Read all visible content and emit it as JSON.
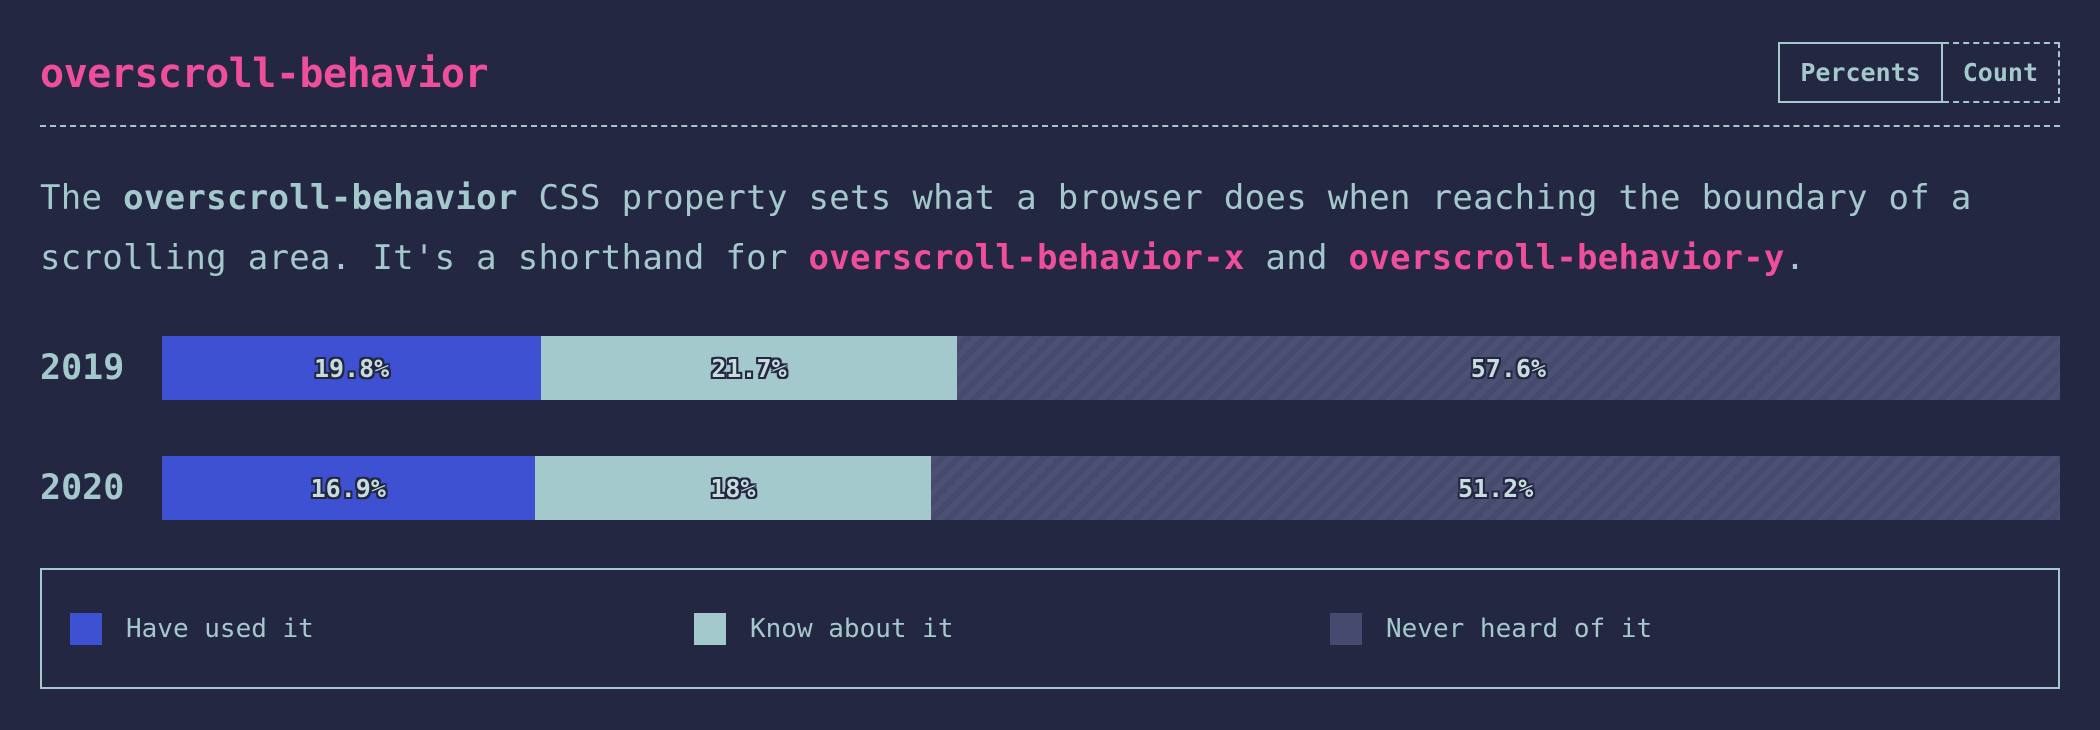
{
  "title": "overscroll-behavior",
  "toggle": {
    "percents": "Percents",
    "count": "Count"
  },
  "description": {
    "part1": "The ",
    "prop": "overscroll-behavior",
    "part2": " CSS property sets what a browser does when reaching the boundary of a scrolling area. It's a shorthand for ",
    "prop_x": "overscroll-behavior-x",
    "part3": " and ",
    "prop_y": "overscroll-behavior-y",
    "part4": "."
  },
  "colors": {
    "used": "#3f51d3",
    "know": "#a3c9cc",
    "never": "#464a6e",
    "accent": "#ef4e9b",
    "background": "#232741"
  },
  "chart_data": {
    "type": "bar",
    "orientation": "horizontal-stacked",
    "categories": [
      "2019",
      "2020"
    ],
    "series": [
      {
        "name": "Have used it",
        "values": [
          19.8,
          16.9
        ],
        "labels": [
          "19.8%",
          "16.9%"
        ]
      },
      {
        "name": "Know about it",
        "values": [
          21.7,
          18
        ],
        "labels": [
          "21.7%",
          "18%"
        ]
      },
      {
        "name": "Never heard of it",
        "values": [
          57.6,
          51.2
        ],
        "labels": [
          "57.6%",
          "51.2%"
        ]
      }
    ]
  }
}
